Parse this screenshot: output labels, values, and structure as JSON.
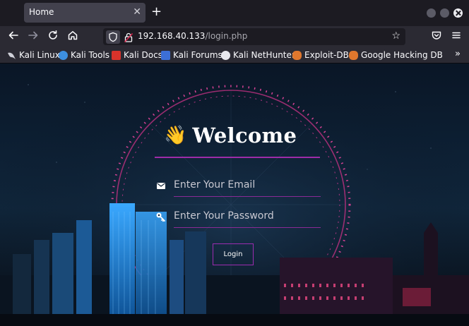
{
  "tab": {
    "title": "Home"
  },
  "url": {
    "host": "192.168.40.133",
    "path": "/login.php"
  },
  "bookmarks": [
    {
      "label": "Kali Linux",
      "icon": "kali-dragon-icon",
      "color": "#3a3a44"
    },
    {
      "label": "Kali Tools",
      "icon": "kali-tools-icon",
      "color": "#3d8fe0"
    },
    {
      "label": "Kali Docs",
      "icon": "kali-docs-icon",
      "color": "#d9332b"
    },
    {
      "label": "Kali Forums",
      "icon": "kali-forums-icon",
      "color": "#3c6fd6"
    },
    {
      "label": "Kali NetHunter",
      "icon": "kali-nethunter-icon",
      "color": "#e8e8ee"
    },
    {
      "label": "Exploit-DB",
      "icon": "exploit-db-icon",
      "color": "#e0772d"
    },
    {
      "label": "Google Hacking DB",
      "icon": "ghdb-icon",
      "color": "#e0772d"
    }
  ],
  "page": {
    "heading": "Welcome",
    "heading_emoji": "👋",
    "email_placeholder": "Enter Your Email",
    "password_placeholder": "Enter Your Password",
    "login_label": "Login"
  },
  "colors": {
    "accent": "#9c2cb0",
    "wheel": "#e0449a",
    "background": "#0d2034"
  }
}
